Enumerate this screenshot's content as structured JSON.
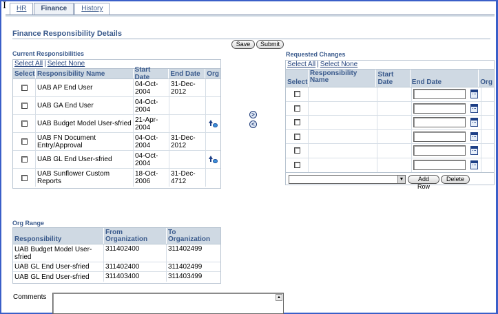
{
  "tabs": [
    {
      "label": "HR",
      "active": false
    },
    {
      "label": "Finance",
      "active": true
    },
    {
      "label": "History",
      "active": false
    }
  ],
  "page_title": "Finance Responsibility Details",
  "buttons": {
    "save": "Save",
    "submit": "Submit",
    "add_row": "Add Row",
    "delete": "Delete"
  },
  "current": {
    "section_title": "Current Responsibilities",
    "select_all": "Select All",
    "select_none": "Select None",
    "separator": "|",
    "columns": [
      "Select",
      "Responsibility Name",
      "Start Date",
      "End Date",
      "Org"
    ],
    "rows": [
      {
        "name": "UAB AP End User",
        "start": "04-Oct-2004",
        "end": "31-Dec-2012",
        "org_icon": false
      },
      {
        "name": "UAB GA End User",
        "start": "04-Oct-2004",
        "end": "",
        "org_icon": false
      },
      {
        "name": "UAB Budget Model User-sfried",
        "start": "21-Apr-2004",
        "end": "",
        "org_icon": true
      },
      {
        "name": "UAB FN Document Entry/Approval",
        "start": "04-Oct-2004",
        "end": "31-Dec-2012",
        "org_icon": false
      },
      {
        "name": "UAB GL End User-sfried",
        "start": "04-Oct-2004",
        "end": "",
        "org_icon": true
      },
      {
        "name": "UAB Sunflower Custom Reports",
        "start": "18-Oct-2006",
        "end": "31-Dec-4712",
        "org_icon": false
      }
    ]
  },
  "shuttle": {
    "move": ">",
    "remove": "<"
  },
  "requested": {
    "section_title": "Requested Changes",
    "select_all": "Select All",
    "select_none": "Select None",
    "separator": "|",
    "columns": [
      "Select",
      "Responsibility Name",
      "Start Date",
      "End Date",
      "Org"
    ],
    "row_count": 6,
    "dropdown_value": ""
  },
  "org_range": {
    "section_title": "Org Range",
    "columns": [
      "Responsibility",
      "From Organization",
      "To Organization"
    ],
    "rows": [
      {
        "responsibility": "UAB Budget Model User-sfried",
        "from": "311402400",
        "to": "311402499"
      },
      {
        "responsibility": "UAB GL End User-sfried",
        "from": "311402400",
        "to": "311402499"
      },
      {
        "responsibility": "UAB GL End User-sfried",
        "from": "311403400",
        "to": "311403499"
      }
    ]
  },
  "comments_label": "Comments",
  "comments_value": "",
  "cursor_glyph": "I",
  "icons": {
    "org": "org-hierarchy-icon",
    "calendar": "calendar-icon",
    "shuttle": "shuttle-arrow-icon"
  },
  "colors": {
    "frame": "#3a5fc8",
    "header_bg": "#cfd9e3",
    "title": "#3a5a8c",
    "link": "#1f3f7a"
  }
}
